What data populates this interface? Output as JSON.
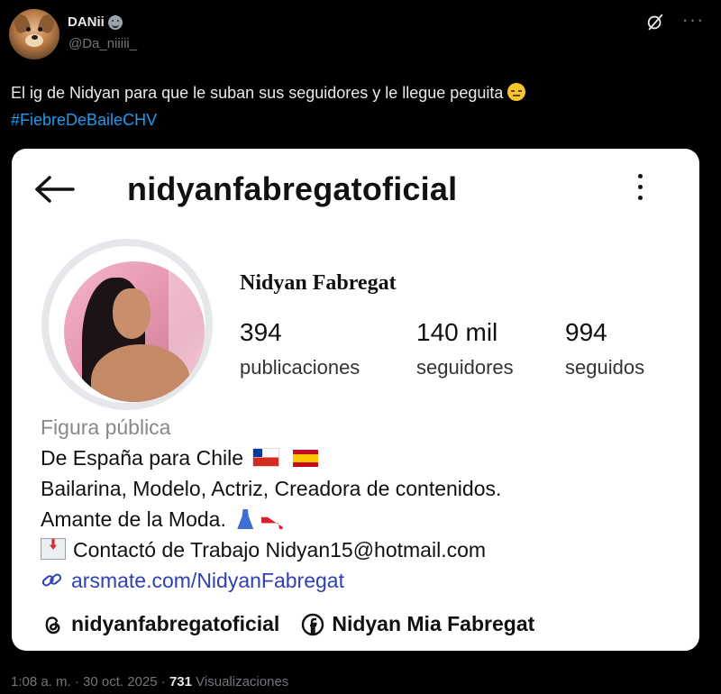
{
  "tweet": {
    "author_name": "DANii",
    "author_handle": "@Da_niiiii_",
    "text": "El ig de Nidyan para que le suban sus seguidores y le llegue peguita",
    "hashtag": "#FiebreDeBaileCHV",
    "time": "1:08 a. m.",
    "date": "30 oct. 2025",
    "views_count": "731",
    "views_label": "Visualizaciones",
    "separator": "·"
  },
  "instagram": {
    "username": "nidyanfabregatoficial",
    "display_name": "Nidyan Fabregat",
    "stats": [
      {
        "value": "394",
        "label": "publicaciones"
      },
      {
        "value": "140 mil",
        "label": "seguidores"
      },
      {
        "value": "994",
        "label": "seguidos"
      }
    ],
    "category": "Figura pública",
    "bio_line1": "De España para Chile",
    "bio_line2": "Bailarina, Modelo, Actriz, Creadora de contenidos.",
    "bio_line3": "Amante de la Moda.",
    "bio_line4": "Contactó de Trabajo Nidyan15@hotmail.com",
    "link": "arsmate.com/NidyanFabregat",
    "threads_handle": "nidyanfabregatoficial",
    "facebook_name": "Nidyan Mia Fabregat"
  },
  "colors": {
    "background": "#000000",
    "hashtag": "#1d9bf0",
    "muted": "#71767b",
    "link": "#2f3fb5"
  }
}
